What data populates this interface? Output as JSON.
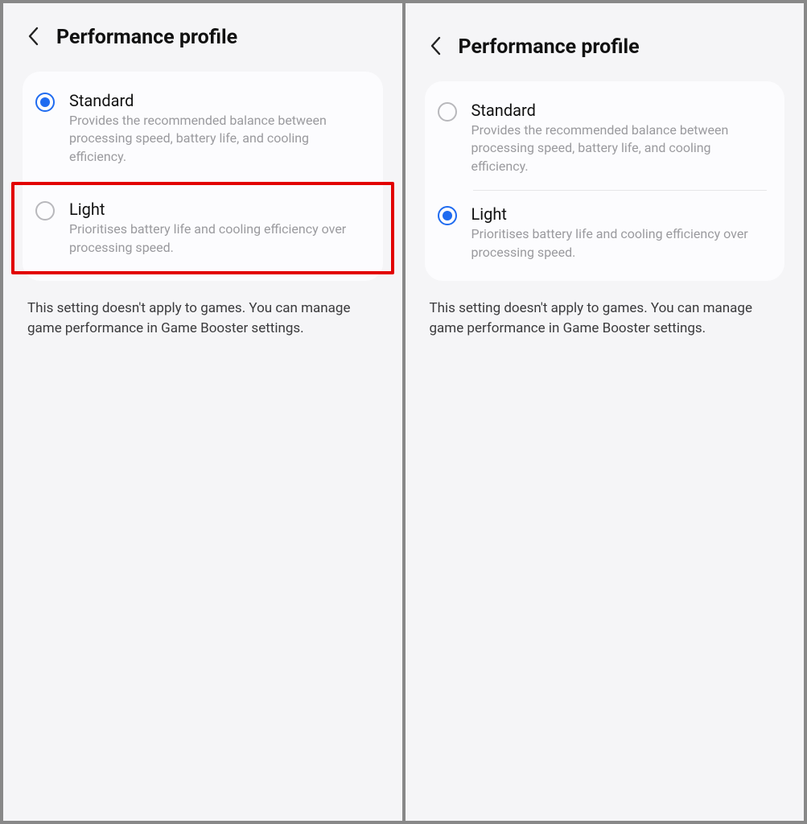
{
  "left": {
    "title": "Performance profile",
    "options": [
      {
        "title": "Standard",
        "desc": "Provides the recommended balance between processing speed, battery life, and cooling efficiency.",
        "selected": true
      },
      {
        "title": "Light",
        "desc": "Prioritises battery life and cooling efficiency over processing speed.",
        "selected": false,
        "highlighted": true
      }
    ],
    "footnote": "This setting doesn't apply to games. You can manage game performance in Game Booster settings."
  },
  "right": {
    "title": "Performance profile",
    "options": [
      {
        "title": "Standard",
        "desc": "Provides the recommended balance between processing speed, battery life, and cooling efficiency.",
        "selected": false
      },
      {
        "title": "Light",
        "desc": "Prioritises battery life and cooling efficiency over processing speed.",
        "selected": true
      }
    ],
    "footnote": "This setting doesn't apply to games. You can manage game performance in Game Booster settings."
  }
}
